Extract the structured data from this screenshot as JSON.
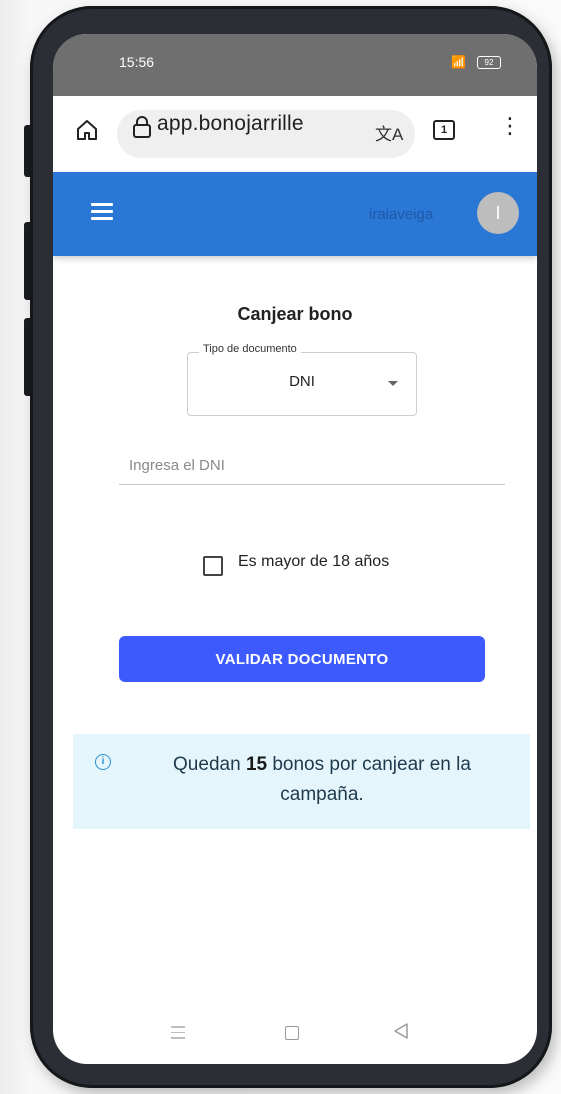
{
  "status_bar": {
    "time": "15:56",
    "signal_icon": "signal-icon",
    "battery": "92"
  },
  "browser": {
    "url": "app.bonojarrille",
    "icons": [
      "home-icon",
      "lock-icon",
      "translate-icon",
      "tabs-icon",
      "more-icon"
    ],
    "tab_count": "1"
  },
  "app_bar": {
    "username": "iraiaveiga",
    "avatar_initial": "I",
    "color": "#2b77d6"
  },
  "form": {
    "title": "Canjear bono",
    "doc_type_label": "Tipo de documento",
    "doc_type_value": "DNI",
    "dni_placeholder": "Ingresa el DNI",
    "dni_value": "",
    "checkbox_label": "Es mayor de 18 años",
    "checkbox_checked": false,
    "validate_label": "VALIDAR DOCUMENTO",
    "button_color": "#3d5afe"
  },
  "info": {
    "prefix": "Quedan",
    "count": "15",
    "suffix": "bonos por canjear en la campaña.",
    "icon": "info-icon"
  }
}
